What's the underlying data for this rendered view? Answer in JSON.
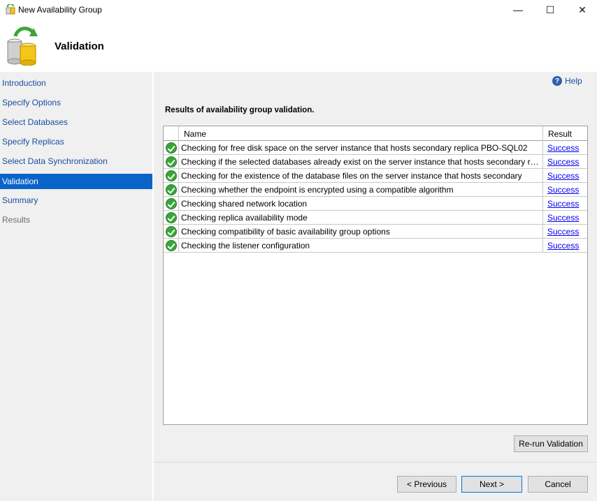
{
  "window": {
    "title": "New Availability Group",
    "minimize_glyph": "—",
    "maximize_glyph": "☐",
    "close_glyph": "✕"
  },
  "header": {
    "title": "Validation",
    "icon": "database-refresh-icon"
  },
  "sidebar": {
    "items": [
      {
        "label": "Introduction",
        "state": "link"
      },
      {
        "label": "Specify Options",
        "state": "link"
      },
      {
        "label": "Select Databases",
        "state": "link"
      },
      {
        "label": "Specify Replicas",
        "state": "link"
      },
      {
        "label": "Select Data Synchronization",
        "state": "link"
      },
      {
        "label": "Validation",
        "state": "active"
      },
      {
        "label": "Summary",
        "state": "link"
      },
      {
        "label": "Results",
        "state": "disabled"
      }
    ]
  },
  "main": {
    "help_label": "Help",
    "results_label": "Results of availability group validation.",
    "grid": {
      "columns": [
        "Name",
        "Result"
      ],
      "rows": [
        {
          "name": "Checking for free disk space on the server instance that hosts secondary replica PBO-SQL02",
          "result": "Success",
          "status_icon": "success-check-icon"
        },
        {
          "name": "Checking if the selected databases already exist on the server instance that hosts secondary repli...",
          "result": "Success",
          "status_icon": "success-check-icon"
        },
        {
          "name": "Checking for the existence of the database files on the server instance that hosts secondary",
          "result": "Success",
          "status_icon": "success-check-icon"
        },
        {
          "name": "Checking whether the endpoint is encrypted using a compatible algorithm",
          "result": "Success",
          "status_icon": "success-check-icon"
        },
        {
          "name": "Checking shared network location",
          "result": "Success",
          "status_icon": "success-check-icon"
        },
        {
          "name": "Checking replica availability mode",
          "result": "Success",
          "status_icon": "success-check-icon"
        },
        {
          "name": "Checking compatibility of basic availability group options",
          "result": "Success",
          "status_icon": "success-check-icon"
        },
        {
          "name": "Checking the listener configuration",
          "result": "Success",
          "status_icon": "success-check-icon"
        }
      ]
    },
    "rerun_label": "Re-run Validation"
  },
  "footer": {
    "previous_label": "< Previous",
    "next_label": "Next >",
    "cancel_label": "Cancel"
  },
  "colors": {
    "nav_link": "#1a4da0",
    "nav_active_bg": "#0a64c8",
    "success_link": "#0000ee",
    "success_icon": "#3aa53a"
  }
}
